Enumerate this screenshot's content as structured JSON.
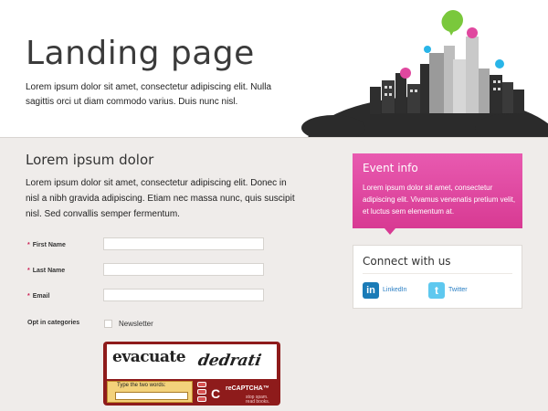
{
  "header": {
    "title": "Landing page",
    "text": "Lorem ipsum dolor sit amet, consectetur adipiscing elit. Nulla sagittis orci ut diam commodo varius. Duis nunc nisl."
  },
  "main": {
    "title": "Lorem ipsum dolor",
    "text": "Lorem ipsum dolor sit amet, consectetur adipiscing elit. Donec in nisl a nibh gravida adipiscing. Etiam nec massa nunc, quis suscipit nisl. Sed convallis semper fermentum."
  },
  "form": {
    "required_marker": "*",
    "first_name_label": "First Name",
    "last_name_label": "Last Name",
    "email_label": "Email",
    "first_name_value": "",
    "last_name_value": "",
    "email_value": "",
    "opt_in_label": "Opt in categories",
    "newsletter_label": "Newsletter"
  },
  "captcha": {
    "word1": "evacuate",
    "word2": "dedrati",
    "prompt": "Type the two words:",
    "logo_mark": "C",
    "brand": "reCAPTCHA™",
    "tagline_1": "stop spam.",
    "tagline_2": "read books."
  },
  "event": {
    "title": "Event info",
    "text": "Lorem ipsum dolor sit amet, consectetur adipiscing elit. Vivamus venenatis pretium velit, et luctus sem elementum at."
  },
  "connect": {
    "title": "Connect with us",
    "linkedin_label": "LinkedIn",
    "linkedin_glyph": "in",
    "twitter_label": "Twitter",
    "twitter_glyph": "t"
  },
  "colors": {
    "accent_pink": "#e0489f",
    "city_dark": "#2e2e2e",
    "bubble_green": "#7ac83c",
    "bubble_blue": "#29b5e8",
    "captcha_red": "#8e1b1b"
  },
  "icons": [
    "city-skyline-icon",
    "linkedin-icon",
    "twitter-icon",
    "captcha-reload-icon",
    "captcha-audio-icon",
    "captcha-help-icon"
  ]
}
